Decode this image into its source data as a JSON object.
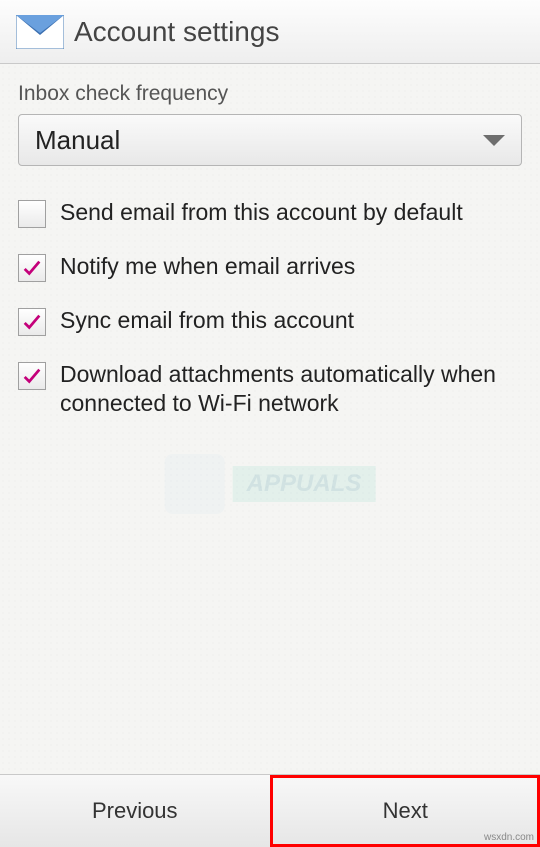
{
  "header": {
    "title": "Account settings"
  },
  "section": {
    "label": "Inbox check frequency"
  },
  "dropdown": {
    "selected": "Manual"
  },
  "options": [
    {
      "label": "Send email from this account by default",
      "checked": false
    },
    {
      "label": "Notify me when email arrives",
      "checked": true
    },
    {
      "label": "Sync email from this account",
      "checked": true
    },
    {
      "label": "Download attachments automatically when connected to Wi-Fi network",
      "checked": true
    }
  ],
  "watermark": {
    "text": "APPUALS"
  },
  "footer": {
    "previous": "Previous",
    "next": "Next"
  },
  "attribution": "wsxdn.com",
  "colors": {
    "check": "#c4007a"
  }
}
